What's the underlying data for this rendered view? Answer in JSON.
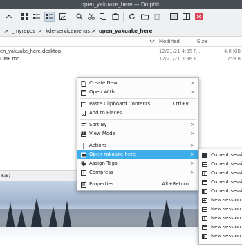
{
  "window": {
    "title": "open_yakuake_here — Dolphin"
  },
  "breadcrumb": {
    "parts": [
      ">",
      "_myrepos",
      ">",
      "kde-servicemenus",
      ">",
      "open_yakuake_here"
    ]
  },
  "columns": {
    "modified": "Modified",
    "size": "Size"
  },
  "files": [
    {
      "name": "en_yakuake_here.desktop",
      "modified": "12/21/21 4:35 P...",
      "size": "4.8 KiB"
    },
    {
      "name": "DME.md",
      "modified": "12/21/21 3:36 P...",
      "size": "759 B"
    }
  ],
  "status": {
    "text": "KiB)"
  },
  "context_menu": {
    "items": [
      {
        "label": "Create New",
        "icon": "document-new-icon",
        "submenu": true
      },
      {
        "label": "Open With",
        "icon": "window-icon",
        "submenu": true
      },
      {
        "label": "Paste Clipboard Contents...",
        "icon": "clipboard-icon",
        "shortcut": "Ctrl+V"
      },
      {
        "label": "Add to Places",
        "icon": "bookmark-icon"
      },
      {
        "label": "Sort By",
        "icon": "sort-icon",
        "submenu": true
      },
      {
        "label": "View Mode",
        "icon": "view-mode-icon",
        "submenu": true
      },
      {
        "label": "Actions",
        "icon": "more-vertical-icon",
        "submenu": true
      },
      {
        "label": "Open Yakuake here",
        "icon": "terminal-icon",
        "submenu": true,
        "highlighted": true
      },
      {
        "label": "Assign Tags",
        "icon": "tag-icon",
        "submenu": true
      },
      {
        "label": "Compress",
        "icon": "archive-icon",
        "submenu": true
      },
      {
        "label": "Properties",
        "icon": "properties-icon",
        "shortcut": "Alt+Return"
      }
    ]
  },
  "yakuake_submenu": {
    "items": [
      {
        "label": "Current session",
        "icon": "terminal-icon"
      },
      {
        "label": "Current session",
        "icon": "split-horizontal-icon"
      },
      {
        "label": "Current session",
        "icon": "split-vertical-icon"
      },
      {
        "label": "Current session",
        "icon": "split-top-icon"
      },
      {
        "label": "Current session",
        "icon": "split-left-icon"
      },
      {
        "label": "New session",
        "icon": "new-session-icon"
      },
      {
        "label": "New session",
        "icon": "split-horizontal-icon"
      },
      {
        "label": "New session",
        "icon": "split-vertical-icon"
      },
      {
        "label": "New session",
        "icon": "split-top-icon"
      },
      {
        "label": "New session",
        "icon": "split-left-icon"
      }
    ]
  },
  "colors": {
    "accent": "#3daee9",
    "titlebar": "#4a4f55",
    "toolbar": "#eff0f1"
  }
}
